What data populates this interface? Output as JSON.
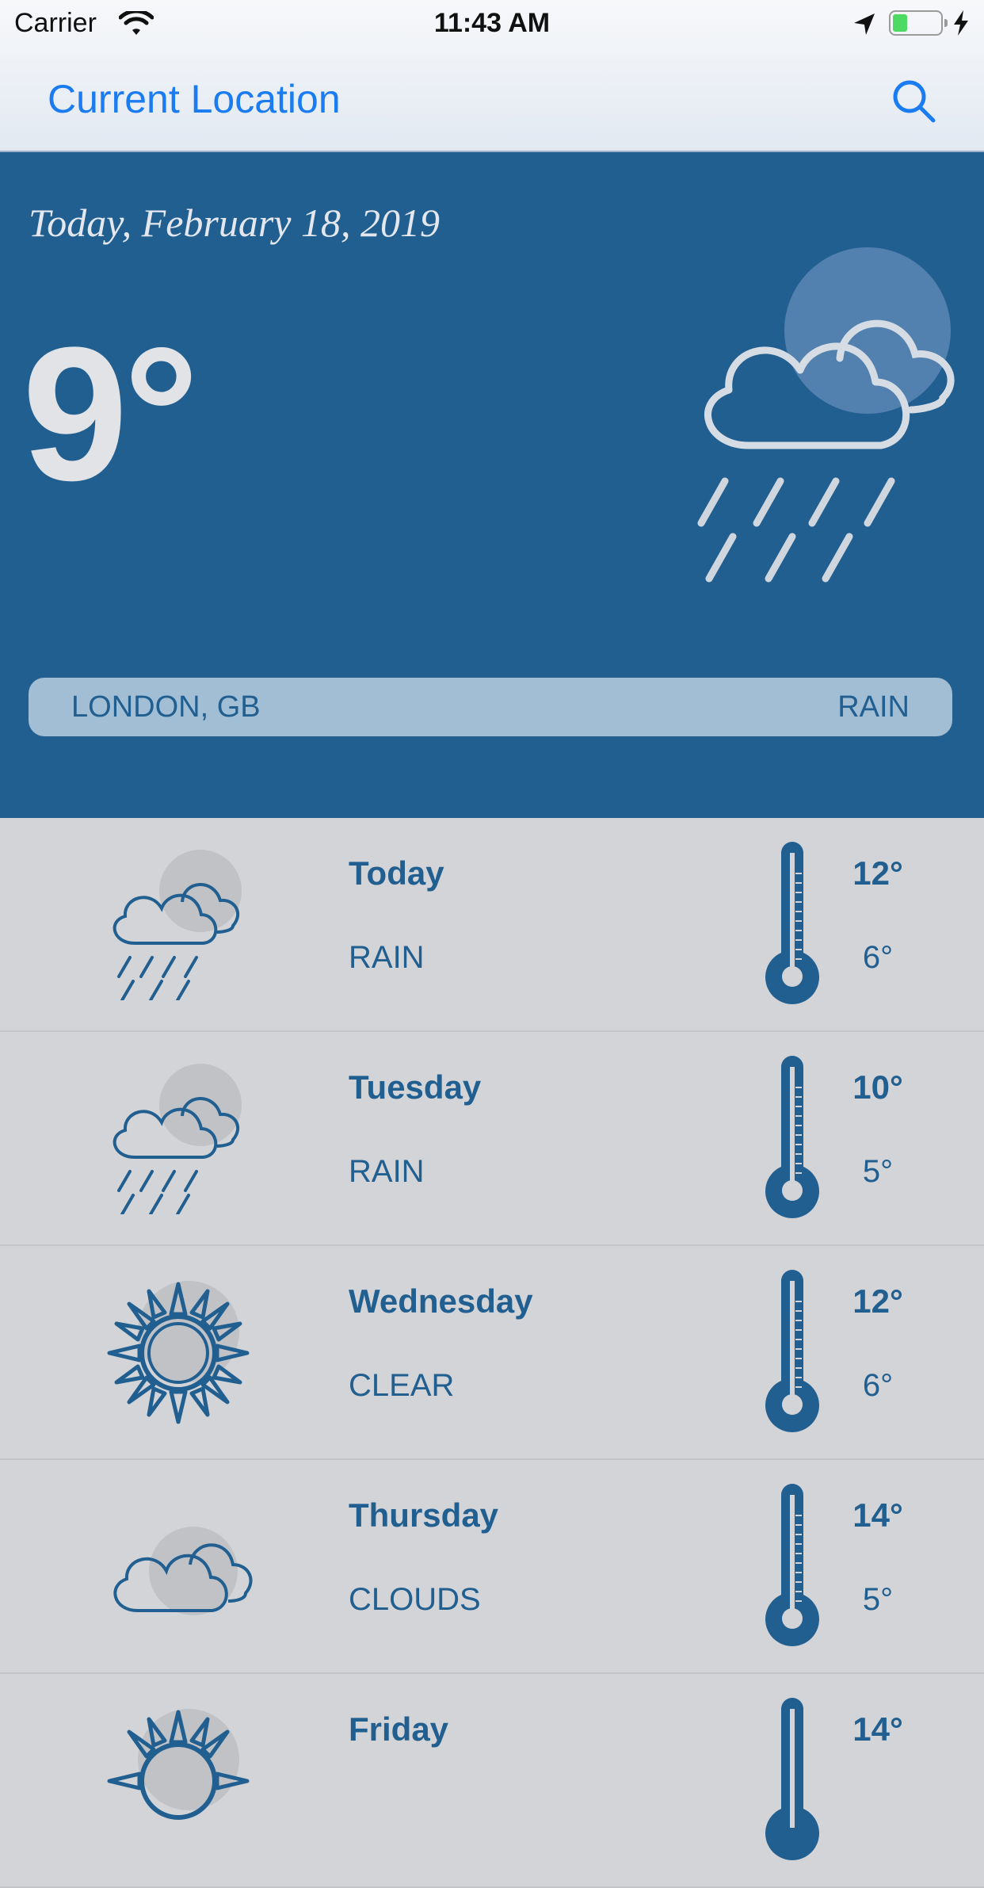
{
  "status_bar": {
    "carrier": "Carrier",
    "time": "11:43 AM",
    "battery_color": "#4cd964"
  },
  "nav": {
    "title": "Current Location",
    "search_icon": "search-icon",
    "accent": "#1a7cf0"
  },
  "current": {
    "date": "Today, February 18, 2019",
    "temperature": "9°",
    "city": "LONDON, GB",
    "condition": "RAIN",
    "icon": "cloud-rain-icon"
  },
  "forecast": [
    {
      "day": "Today",
      "condition": "RAIN",
      "high": "12°",
      "low": "6°",
      "icon": "cloud-rain-icon"
    },
    {
      "day": "Tuesday",
      "condition": "RAIN",
      "high": "10°",
      "low": "5°",
      "icon": "cloud-rain-icon"
    },
    {
      "day": "Wednesday",
      "condition": "CLEAR",
      "high": "12°",
      "low": "6°",
      "icon": "sun-icon"
    },
    {
      "day": "Thursday",
      "condition": "CLOUDS",
      "high": "14°",
      "low": "5°",
      "icon": "cloud-icon"
    },
    {
      "day": "Friday",
      "condition": "",
      "high": "14°",
      "low": "",
      "icon": "sun-icon"
    }
  ],
  "colors": {
    "primary": "#215f91",
    "list_bg": "#d3d4d7",
    "hero_bar": "#a2bed4"
  }
}
